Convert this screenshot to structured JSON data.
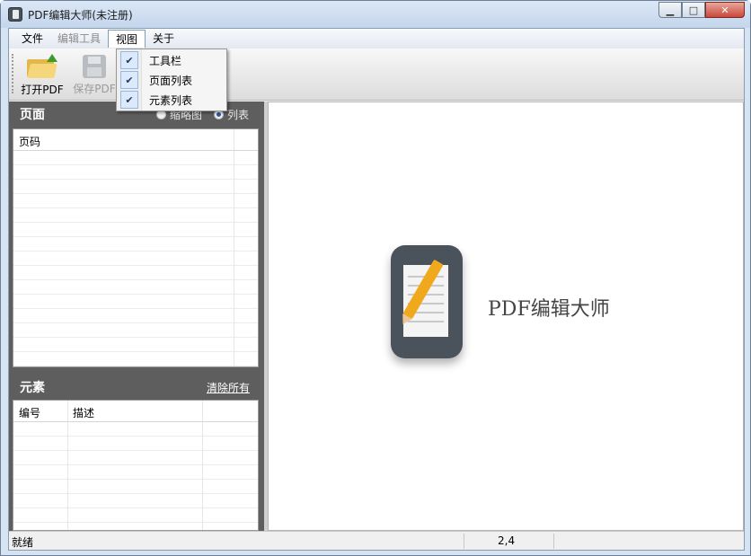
{
  "window": {
    "title": "PDF编辑大师(未注册)"
  },
  "menu": {
    "file": "文件",
    "edit_tools": "编辑工具",
    "view": "视图",
    "about": "关于"
  },
  "toolbar": {
    "open_pdf": "打开PDF",
    "save_pdf": "保存PDF"
  },
  "view_menu": {
    "items": [
      {
        "label": "工具栏",
        "checked": true
      },
      {
        "label": "页面列表",
        "checked": true
      },
      {
        "label": "元素列表",
        "checked": true
      }
    ]
  },
  "pages_panel": {
    "title": "页面",
    "thumbnail_option": "缩略图",
    "list_option": "列表",
    "selected_option": "列表",
    "column_page_number": "页码"
  },
  "elements_panel": {
    "title": "元素",
    "clear_all": "清除所有",
    "column_number": "编号",
    "column_description": "描述"
  },
  "canvas": {
    "logo_text": "PDF编辑大师"
  },
  "statusbar": {
    "status": "就绪",
    "position": "2,4"
  },
  "colors": {
    "panel_bg": "#5e5e5e",
    "logo_bg": "#4a525c",
    "pencil": "#f0a81d"
  }
}
